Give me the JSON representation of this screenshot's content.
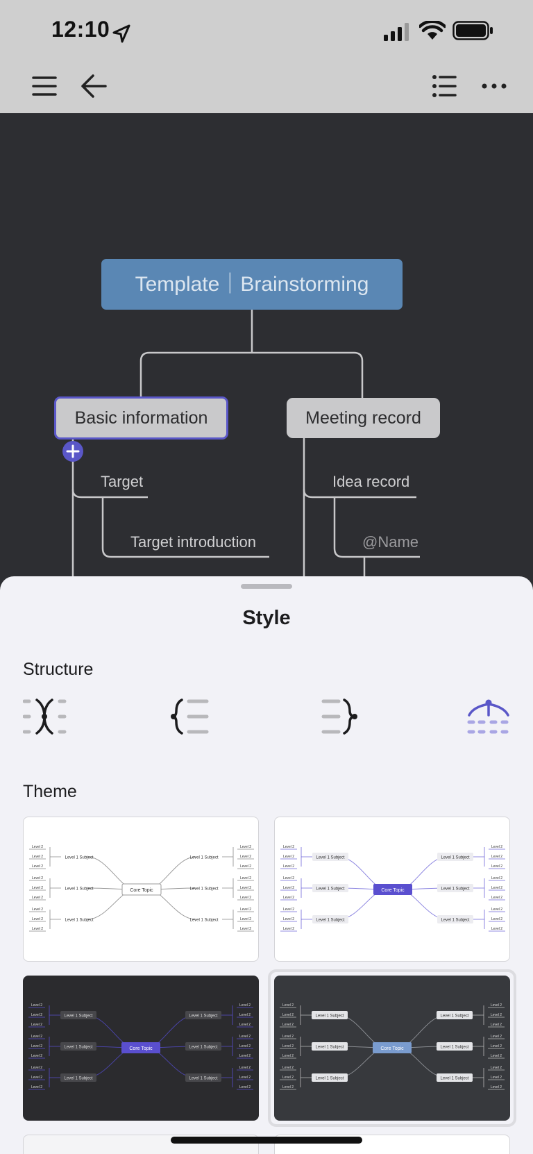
{
  "status_bar": {
    "time": "12:10"
  },
  "toolbar": {
    "menu_icon": "hamburger-menu-icon",
    "back_icon": "back-arrow-icon",
    "outline_icon": "outline-list-icon",
    "more_icon": "more-ellipsis-icon"
  },
  "mindmap": {
    "root": "Template｜Brainstorming",
    "branches": [
      {
        "label": "Basic information",
        "children": [
          "Target",
          "Target  introduction"
        ]
      },
      {
        "label": "Meeting record",
        "children": [
          "Idea record",
          "@Name"
        ]
      }
    ],
    "colors": {
      "canvas": "#2d2e32",
      "root": "#5a87b4",
      "selection": "#5a57c8"
    }
  },
  "style_sheet": {
    "title": "Style",
    "structure_label": "Structure",
    "structures": [
      "mind-map-structure",
      "left-tree-structure",
      "right-tree-structure",
      "org-chart-structure"
    ],
    "selected_structure": 3,
    "theme_label": "Theme",
    "theme_texts": {
      "core": "Core Topic",
      "level1": "Level 1 Subject",
      "level2": "Level 2"
    },
    "themes": [
      {
        "name": "light-classic",
        "bg": "#ffffff",
        "accent": "#ffffff"
      },
      {
        "name": "light-purple",
        "bg": "#ffffff",
        "accent": "#5a4fcf"
      },
      {
        "name": "dark-purple",
        "bg": "#2b2b2e",
        "accent": "#5a4fcf"
      },
      {
        "name": "dark-blue",
        "bg": "#37393d",
        "accent": "#7a9ccf",
        "selected": true
      }
    ]
  }
}
